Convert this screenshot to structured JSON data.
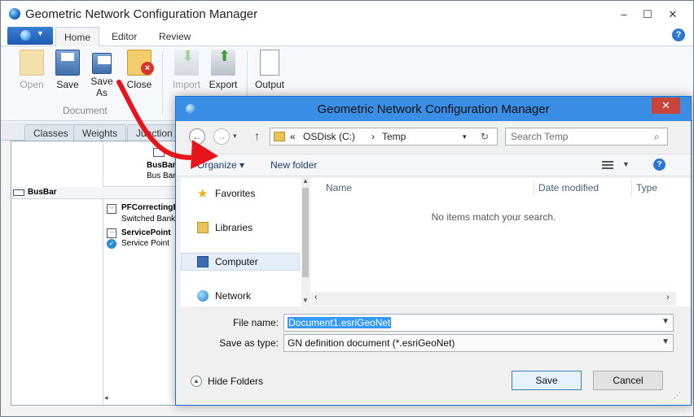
{
  "main_window": {
    "title": "Geometric Network Configuration Manager",
    "controls": {
      "minimize": "–",
      "maximize": "☐",
      "close": "✕"
    }
  },
  "ribbon": {
    "tabs": [
      {
        "label": "Home"
      },
      {
        "label": "Editor"
      },
      {
        "label": "Review"
      }
    ],
    "active_tab": "Home",
    "help": "?",
    "buttons": {
      "open": {
        "label": "Open",
        "icon": "open-folder-icon",
        "enabled": false
      },
      "save": {
        "label": "Save",
        "icon": "save-disk-icon",
        "enabled": true
      },
      "save_as": {
        "line1": "Save",
        "line2": "As",
        "icon": "save-as-icon",
        "enabled": true
      },
      "close": {
        "label": "Close",
        "icon": "close-folder-icon",
        "enabled": true
      },
      "import": {
        "label": "Import",
        "icon": "import-icon",
        "enabled": false
      },
      "export": {
        "label": "Export",
        "icon": "export-icon",
        "enabled": true
      },
      "output": {
        "label": "Output",
        "icon": "output-page-icon",
        "enabled": true
      }
    },
    "group_label": "Document"
  },
  "sub_tabs": [
    {
      "label": "Classes"
    },
    {
      "label": "Weights"
    },
    {
      "label": "Junction R"
    }
  ],
  "grid": {
    "column_header": {
      "title": "BusBar",
      "subtitle": "Bus Bar"
    },
    "row_header": "BusBar",
    "cells": [
      {
        "title": "PFCorrectingE",
        "subtitle": "Switched Bank"
      },
      {
        "title": "ServicePoint",
        "subtitle": "Service Point"
      }
    ]
  },
  "dialog": {
    "title": "Geometric Network Configuration Manager",
    "close": "✕",
    "address": {
      "prefix": "«",
      "drive": "OSDisk (C:)",
      "separator": "›",
      "folder": "Temp"
    },
    "search_placeholder": "Search Temp",
    "toolbar": {
      "organize": "Organize ▾",
      "new_folder": "New folder",
      "help": "?"
    },
    "nav_items": [
      {
        "label": "Favorites",
        "icon": "star-icon"
      },
      {
        "label": "Libraries",
        "icon": "libraries-icon"
      },
      {
        "label": "Computer",
        "icon": "computer-icon"
      },
      {
        "label": "Network",
        "icon": "network-icon"
      }
    ],
    "selected_nav": "Computer",
    "columns": [
      {
        "label": "Name"
      },
      {
        "label": "Date modified"
      },
      {
        "label": "Type"
      }
    ],
    "empty_message": "No items match your search.",
    "file_name_label": "File name:",
    "file_name_value": "Document1.esriGeoNet",
    "save_type_label": "Save as type:",
    "save_type_value": "GN definition document (*.esriGeoNet)",
    "hide_folders": "Hide Folders",
    "save_button": "Save",
    "cancel_button": "Cancel"
  },
  "colors": {
    "annotation_arrow": "#e8141b",
    "dialog_titlebar": "#3a8ee6",
    "accent": "#1d5bb0"
  }
}
